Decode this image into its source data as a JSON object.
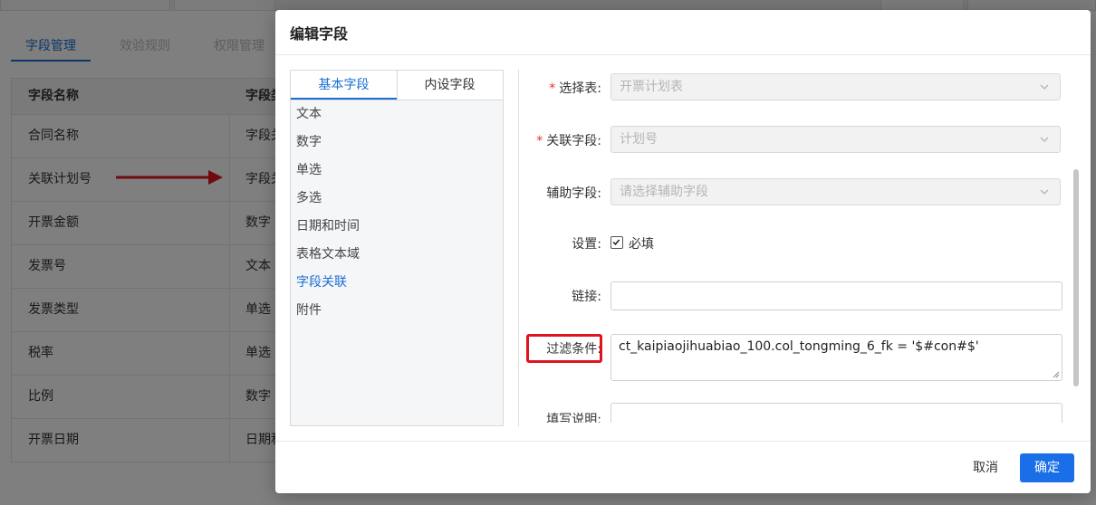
{
  "background": {
    "sub_tabs": [
      {
        "label": "字段管理",
        "active": true
      },
      {
        "label": "效验规则",
        "active": false
      },
      {
        "label": "权限管理",
        "active": false
      }
    ],
    "table": {
      "headers": [
        "字段名称",
        "字段类型"
      ],
      "rows": [
        [
          "合同名称",
          "字段关联"
        ],
        [
          "关联计划号",
          "字段关联"
        ],
        [
          "开票金额",
          "数字"
        ],
        [
          "发票号",
          "文本"
        ],
        [
          "发票类型",
          "单选"
        ],
        [
          "税率",
          "单选"
        ],
        [
          "比例",
          "数字"
        ],
        [
          "开票日期",
          "日期和时间"
        ]
      ]
    }
  },
  "modal": {
    "title": "编辑字段",
    "left_tabs": [
      {
        "label": "基本字段",
        "active": true
      },
      {
        "label": "内设字段",
        "active": false
      }
    ],
    "field_types": [
      {
        "label": "文本",
        "active": false
      },
      {
        "label": "数字",
        "active": false
      },
      {
        "label": "单选",
        "active": false
      },
      {
        "label": "多选",
        "active": false
      },
      {
        "label": "日期和时间",
        "active": false
      },
      {
        "label": "表格文本域",
        "active": false
      },
      {
        "label": "字段关联",
        "active": true
      },
      {
        "label": "附件",
        "active": false
      }
    ],
    "form": {
      "select_table": {
        "required_mark": "*",
        "label": "选择表:",
        "value": "开票计划表"
      },
      "link_field": {
        "required_mark": "*",
        "label": "关联字段:",
        "value": "计划号"
      },
      "aux_field": {
        "label": "辅助字段:",
        "placeholder": "请选择辅助字段"
      },
      "settings": {
        "label": "设置:",
        "checkbox_label": "必填",
        "checked": true
      },
      "link": {
        "label": "链接:",
        "value": ""
      },
      "filter": {
        "label": "过滤条件:",
        "value": "ct_kaipiaojihuabiao_100.col_tongming_6_fk = '$#con#$'"
      },
      "fill_desc": {
        "label": "填写说明:"
      }
    },
    "buttons": {
      "cancel": "取消",
      "ok": "确定"
    }
  },
  "colors": {
    "accent": "#1a6fd1",
    "primary_button": "#1a6fe8",
    "highlight": "#e0141e",
    "required": "#e0362c"
  }
}
